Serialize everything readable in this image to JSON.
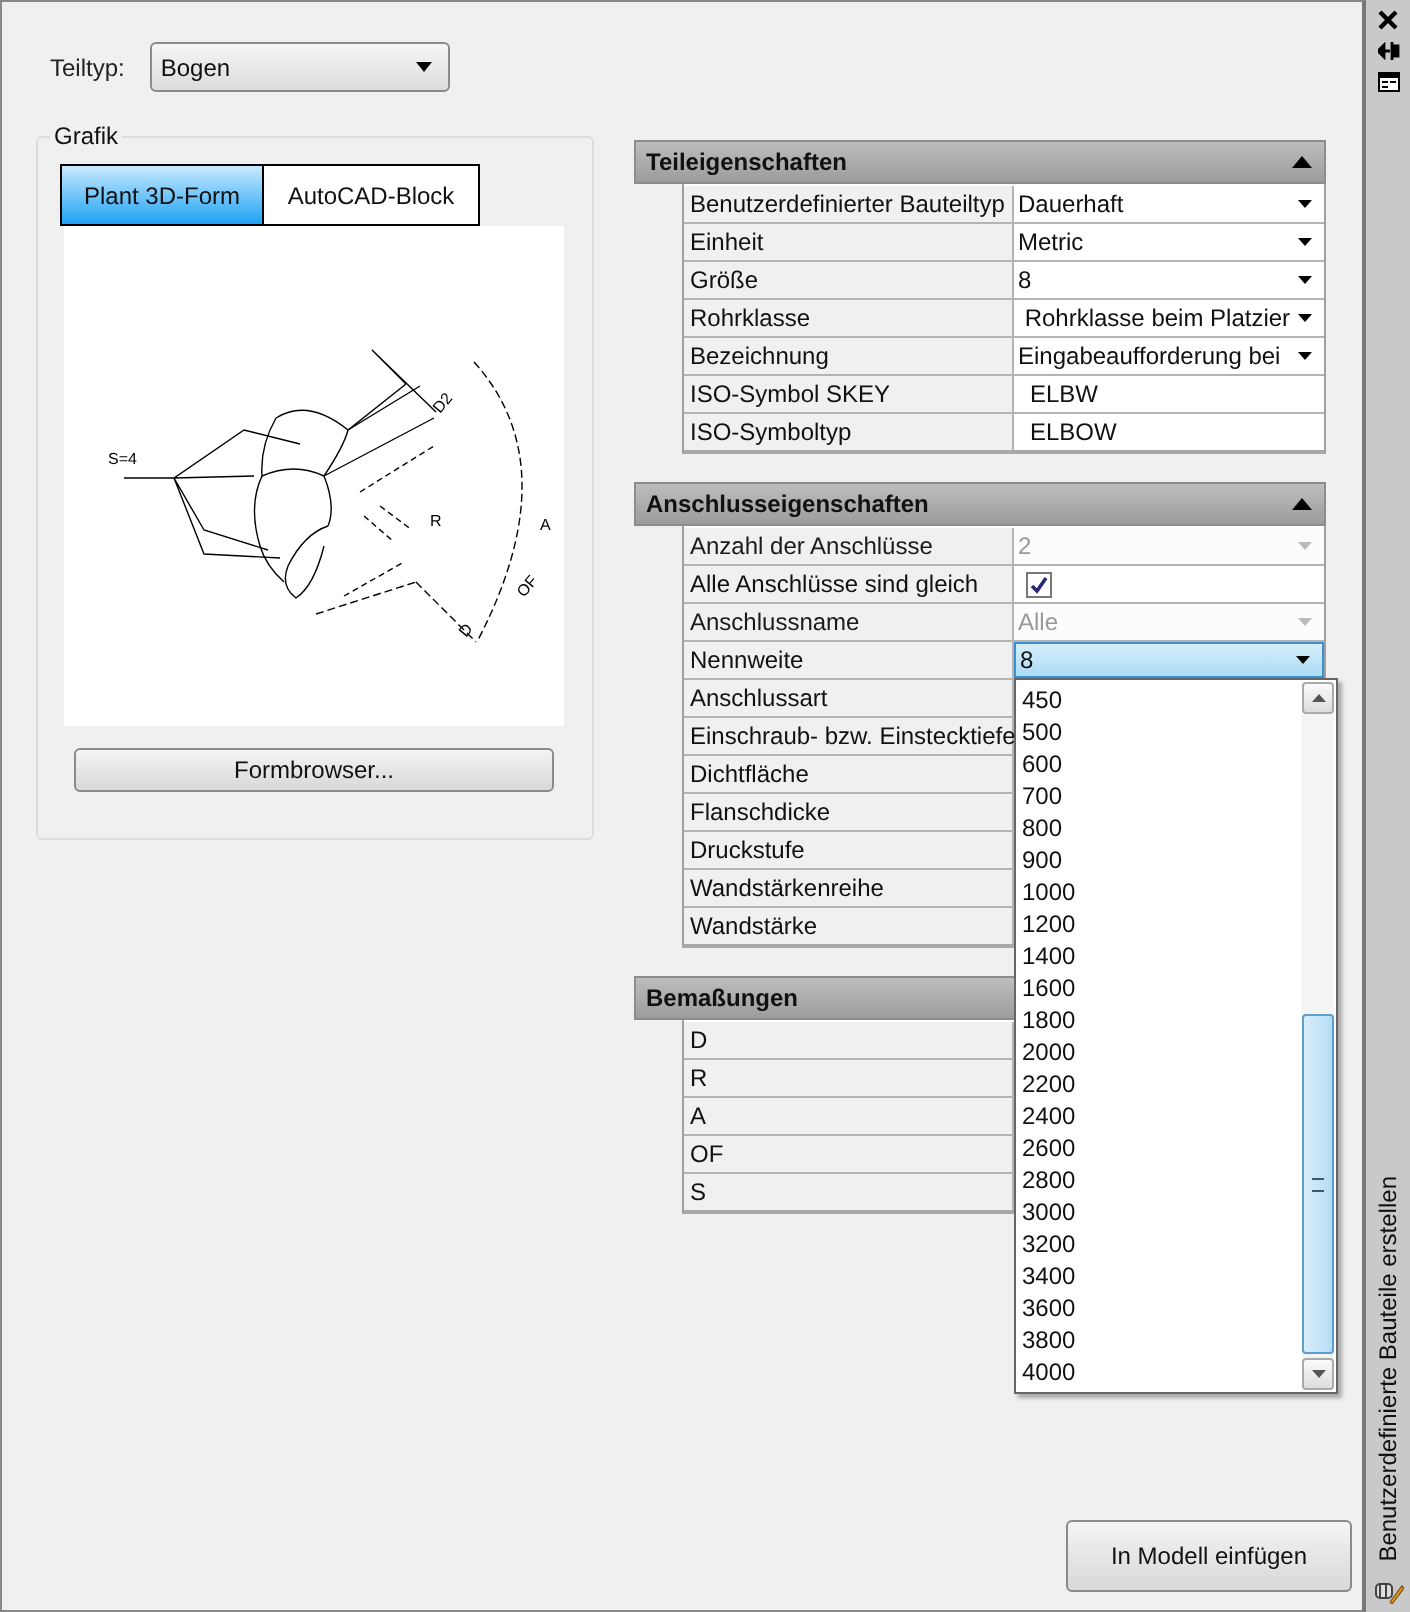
{
  "part_type": {
    "label": "Teiltyp:",
    "value": "Bogen"
  },
  "graphic": {
    "title": "Grafik",
    "tabs": [
      {
        "label": "Plant 3D-Form",
        "selected": true
      },
      {
        "label": "AutoCAD-Block",
        "selected": false
      }
    ],
    "drawing_labels": [
      "S=4",
      "D2",
      "R",
      "A",
      "OF",
      "D"
    ],
    "button": "Formbrowser..."
  },
  "sections": [
    {
      "title": "Teileigenschaften",
      "expanded": true,
      "rows": [
        {
          "label": "Benutzerdefinierter Bauteiltyp",
          "kind": "dropdown",
          "value": "Dauerhaft",
          "disabled": false
        },
        {
          "label": "Einheit",
          "kind": "dropdown",
          "value": "Metric",
          "disabled": false
        },
        {
          "label": "Größe",
          "kind": "dropdown",
          "value": "8",
          "disabled": false
        },
        {
          "label": "Rohrklasse",
          "kind": "dropdown",
          "value": " Rohrklasse beim Platzier",
          "disabled": false
        },
        {
          "label": "Bezeichnung",
          "kind": "dropdown",
          "value": "Eingabeaufforderung bei",
          "disabled": false
        },
        {
          "label": "ISO-Symbol SKEY",
          "kind": "text",
          "value": "ELBW"
        },
        {
          "label": "ISO-Symboltyp",
          "kind": "text",
          "value": "ELBOW"
        }
      ]
    },
    {
      "title": "Anschlusseigenschaften",
      "expanded": true,
      "rows": [
        {
          "label": "Anzahl der Anschlüsse",
          "kind": "dropdown",
          "value": "2",
          "disabled": true
        },
        {
          "label": "Alle Anschlüsse sind gleich",
          "kind": "checkbox",
          "checked": true
        },
        {
          "label": "Anschlussname",
          "kind": "dropdown",
          "value": "Alle",
          "disabled": true
        },
        {
          "label": "Nennweite",
          "kind": "dropdown",
          "value": "8",
          "disabled": false,
          "open": true,
          "options": [
            "450",
            "500",
            "600",
            "700",
            "800",
            "900",
            "1000",
            "1200",
            "1400",
            "1600",
            "1800",
            "2000",
            "2200",
            "2400",
            "2600",
            "2800",
            "3000",
            "3200",
            "3400",
            "3600",
            "3800",
            "4000"
          ]
        },
        {
          "label": "Anschlussart",
          "kind": "text"
        },
        {
          "label": "Einschraub- bzw. Einstecktiefe",
          "kind": "text"
        },
        {
          "label": "Dichtfläche",
          "kind": "text"
        },
        {
          "label": "Flanschdicke",
          "kind": "text"
        },
        {
          "label": "Druckstufe",
          "kind": "text"
        },
        {
          "label": "Wandstärkenreihe",
          "kind": "text"
        },
        {
          "label": "Wandstärke",
          "kind": "text"
        }
      ]
    },
    {
      "title": "Bemaßungen",
      "expanded": true,
      "rows": [
        {
          "label": "D",
          "kind": "text"
        },
        {
          "label": "R",
          "kind": "text"
        },
        {
          "label": "A",
          "kind": "text"
        },
        {
          "label": "OF",
          "kind": "text"
        },
        {
          "label": "S",
          "kind": "text"
        }
      ]
    }
  ],
  "insert_button": "In Modell einfügen",
  "side_title": "Benutzerdefinierte Bauteile erstellen"
}
